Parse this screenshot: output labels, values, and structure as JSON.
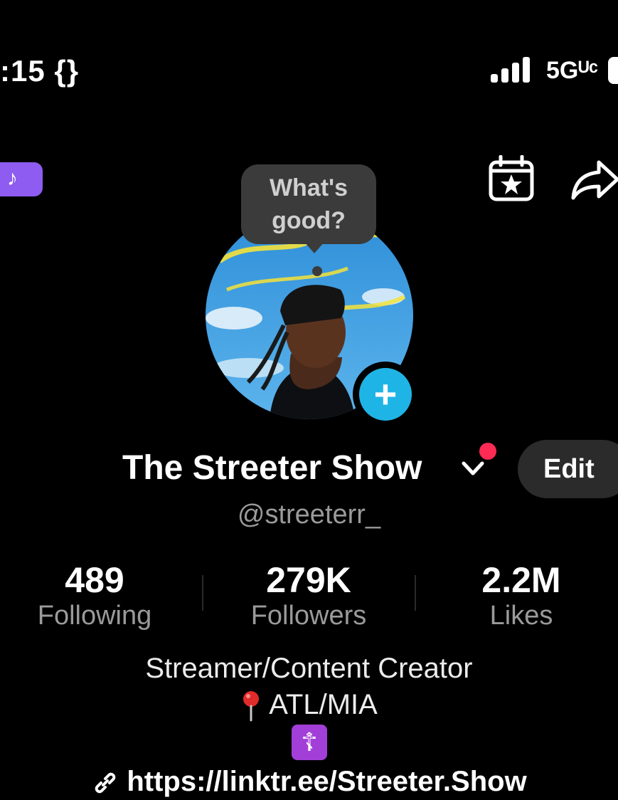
{
  "status_bar": {
    "time": ":15 {}",
    "network": "5Gᵁᶜ"
  },
  "top_bar": {
    "tiktok_badge_icon": "tiktok-note-icon",
    "calendar_icon": "calendar-star-icon",
    "share_icon": "share-arrow-icon"
  },
  "bubble": {
    "text_line1": "What's",
    "text_line2": "good?"
  },
  "profile": {
    "display_name": "The Streeter Show",
    "handle": "@streeterr_",
    "edit_label": "Edit",
    "add_button_glyph": "+"
  },
  "stats": [
    {
      "value": "489",
      "label": "Following"
    },
    {
      "value": "279K",
      "label": "Followers"
    },
    {
      "value": "2.2M",
      "label": "Likes"
    }
  ],
  "bio": {
    "line1": "Streamer/Content Creator",
    "line2": "ATL/MIA",
    "cross_glyph": "☦",
    "link": "https://linktr.ee/Streeter.Show"
  },
  "colors": {
    "background": "#000000",
    "accent_blue": "#1fb4e6",
    "notification_red": "#ff2b55",
    "tiktok_purple": "#8e5cf0",
    "muted_text": "#9a9a9a"
  }
}
